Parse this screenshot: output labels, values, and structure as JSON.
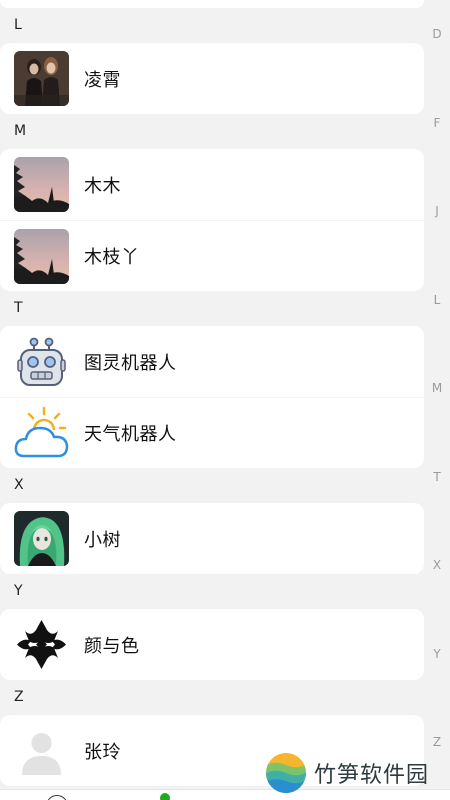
{
  "sections": [
    {
      "letter": "L",
      "contacts": [
        {
          "name": "凌霄",
          "avatar": "photo-couple"
        }
      ]
    },
    {
      "letter": "M",
      "contacts": [
        {
          "name": "木木",
          "avatar": "photo-sunset-trees"
        },
        {
          "name": "木枝丫",
          "avatar": "photo-sunset-trees"
        }
      ]
    },
    {
      "letter": "T",
      "contacts": [
        {
          "name": "图灵机器人",
          "avatar": "robot-icon"
        },
        {
          "name": "天气机器人",
          "avatar": "weather-icon"
        }
      ]
    },
    {
      "letter": "X",
      "contacts": [
        {
          "name": "小树",
          "avatar": "anime-girl-green"
        }
      ]
    },
    {
      "letter": "Y",
      "contacts": [
        {
          "name": "颜与色",
          "avatar": "black-emblem"
        }
      ]
    },
    {
      "letter": "Z",
      "contacts": [
        {
          "name": "张玲",
          "avatar": "default-person-icon"
        }
      ]
    }
  ],
  "index_letters": [
    "D",
    "F",
    "J",
    "L",
    "M",
    "T",
    "X",
    "Y",
    "Z"
  ],
  "watermark": {
    "text": "竹笋软件园"
  },
  "colors": {
    "background": "#f2f2f2",
    "card": "#ffffff",
    "index_text": "#9b9b9b",
    "accent_green": "#1aad19"
  }
}
